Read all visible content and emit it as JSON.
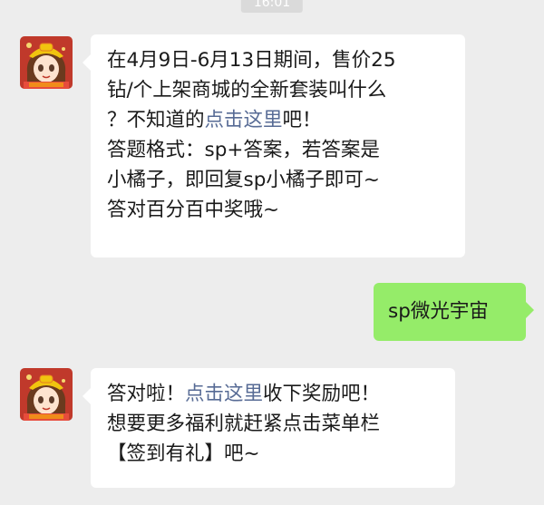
{
  "timestamp": "16:01",
  "messages": [
    {
      "sender": "official-account",
      "lines": [
        {
          "text": "在4月9日-6月13日期间，售价25"
        },
        {
          "text": "钻/个上架商城的全新套装叫什么"
        },
        {
          "pre": "？不知道的",
          "link": "点击这里",
          "post": "吧！"
        },
        {
          "text": "答题格式：sp+答案，若答案是"
        },
        {
          "text": "小橘子，即回复sp小橘子即可~"
        },
        {
          "text": "答对百分百中奖哦~"
        }
      ]
    },
    {
      "sender": "user",
      "text": "sp微光宇宙"
    },
    {
      "sender": "official-account",
      "lines": [
        {
          "pre": "答对啦！",
          "link": "点击这里",
          "post": "收下奖励吧！"
        },
        {
          "text": "想要更多福利就赶紧点击菜单栏"
        },
        {
          "text": "【签到有礼】吧~"
        }
      ]
    }
  ],
  "colors": {
    "background": "#ededed",
    "bubble_incoming": "#ffffff",
    "bubble_outgoing": "#95ec69",
    "link": "#576b95"
  }
}
